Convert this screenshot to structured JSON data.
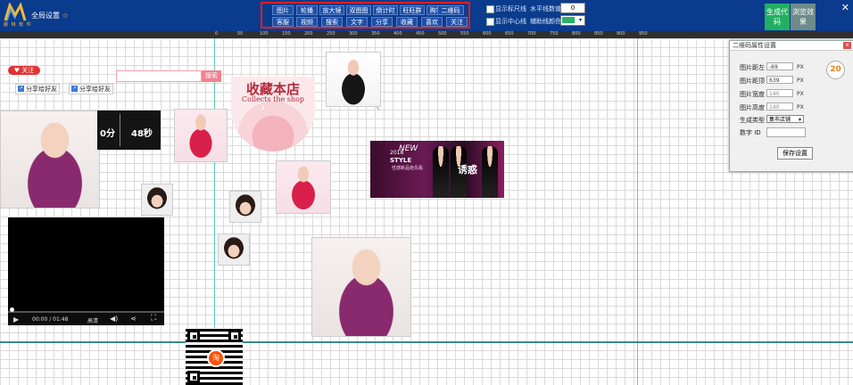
{
  "header": {
    "logo_text": "晨 特 软 件",
    "global_title": "全局设置",
    "star": "☆",
    "close": "✕"
  },
  "toolbox": {
    "row1": [
      "图片",
      "轮播",
      "放大镜",
      "双图图",
      "倒计时",
      "旺旺群",
      "购物车",
      "二维码"
    ],
    "row2": [
      "客服",
      "视频",
      "搜索",
      "文字",
      "分享",
      "收藏",
      "喜欢",
      "关注"
    ]
  },
  "options": {
    "show_ruler": "显示标尺线",
    "show_center": "显示中心线",
    "h_spacing_label": "水平线数值",
    "h_spacing_value": "0",
    "aux_color_label": "辅助线颜色",
    "aux_color": "#29b06a"
  },
  "actions": {
    "generate": "生成代码",
    "preview": "浏览效果",
    "generate_color": "#21b062",
    "preview_color": "#6d8b8a"
  },
  "ruler": [
    "0",
    "50",
    "100",
    "150",
    "200",
    "250",
    "300",
    "350",
    "400",
    "450",
    "500",
    "550",
    "600",
    "650",
    "700",
    "750",
    "800",
    "850",
    "900",
    "950"
  ],
  "canvas": {
    "follow": "关注",
    "share1": "分享给好友",
    "share2": "分享给好友",
    "search_btn": "搜索",
    "countdown_a": "0分",
    "countdown_b": "48秒",
    "collect_cn": "收藏本店",
    "collect_en": "Collects the shop",
    "banner_year": "2018",
    "banner_new": "NEW",
    "banner_style": "STYLE",
    "banner_cn": "性感新品抢先看",
    "banner_big": "诱惑",
    "video_time": "00:00 / 01:48",
    "video_quality": "高清",
    "qr_logo": "淘"
  },
  "qrpanel": {
    "title": "二维码属性设置",
    "close": "x",
    "left_label": "图片距左",
    "left_value": "-69",
    "top_label": "图片距顶",
    "top_value": "639",
    "width_label": "图片宽度",
    "width_value": "140",
    "height_label": "图片高度",
    "height_value": "140",
    "unit": "PX",
    "type_label": "生成类型",
    "type_value": "集市店铺",
    "id_label": "数字 ID",
    "save": "保存设置",
    "badge": "20"
  }
}
